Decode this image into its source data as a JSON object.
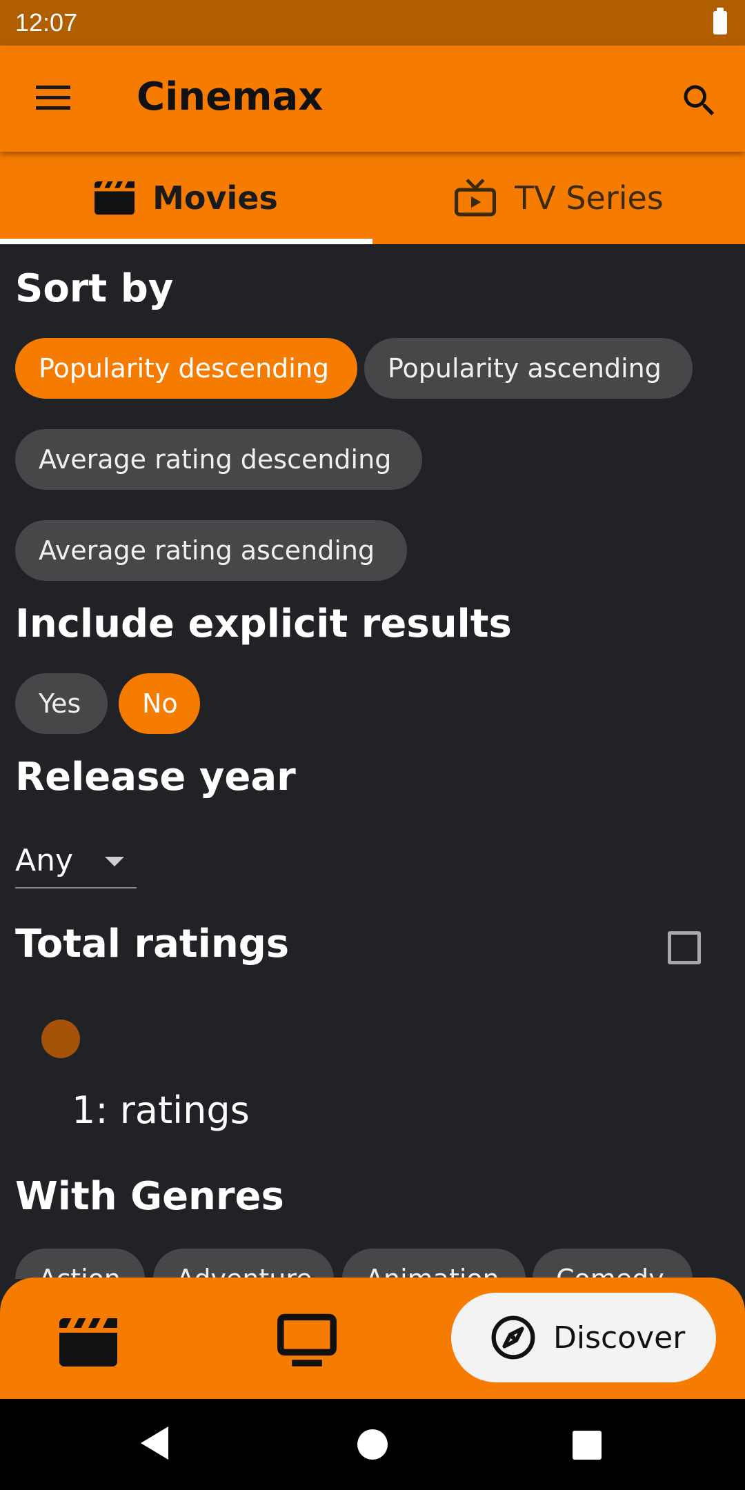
{
  "status_bar": {
    "time": "12:07"
  },
  "app_bar": {
    "title": "Cinemax",
    "menu_icon": "hamburger-menu-icon",
    "search_icon": "search-icon"
  },
  "tabs": [
    {
      "label": "Movies",
      "icon": "clapperboard-icon",
      "active": true
    },
    {
      "label": "TV Series",
      "icon": "tv-icon",
      "active": false
    }
  ],
  "sort": {
    "title": "Sort by",
    "options": [
      {
        "label": "Popularity descending",
        "selected": true
      },
      {
        "label": "Popularity ascending",
        "selected": false
      },
      {
        "label": "Average rating descending",
        "selected": false
      },
      {
        "label": "Average rating ascending",
        "selected": false
      }
    ]
  },
  "explicit": {
    "title": "Include explicit results",
    "options": [
      {
        "label": "Yes",
        "selected": false
      },
      {
        "label": "No",
        "selected": true
      }
    ]
  },
  "release_year": {
    "title": "Release year",
    "value": "Any"
  },
  "total_ratings": {
    "title": "Total ratings",
    "checked": false,
    "slider_label": "1: ratings"
  },
  "genres": {
    "title": "With Genres",
    "options": [
      "Action",
      "Adventure",
      "Animation",
      "Comedy"
    ]
  },
  "bottom_nav": {
    "items": [
      {
        "icon": "clapperboard-icon"
      },
      {
        "icon": "tv-icon"
      },
      {
        "icon": "compass-icon",
        "label": "Discover",
        "active": true
      }
    ]
  },
  "colors": {
    "accent": "#F57C00",
    "status_bar": "#B15E00",
    "background": "#212226",
    "chip": "#47474A"
  }
}
